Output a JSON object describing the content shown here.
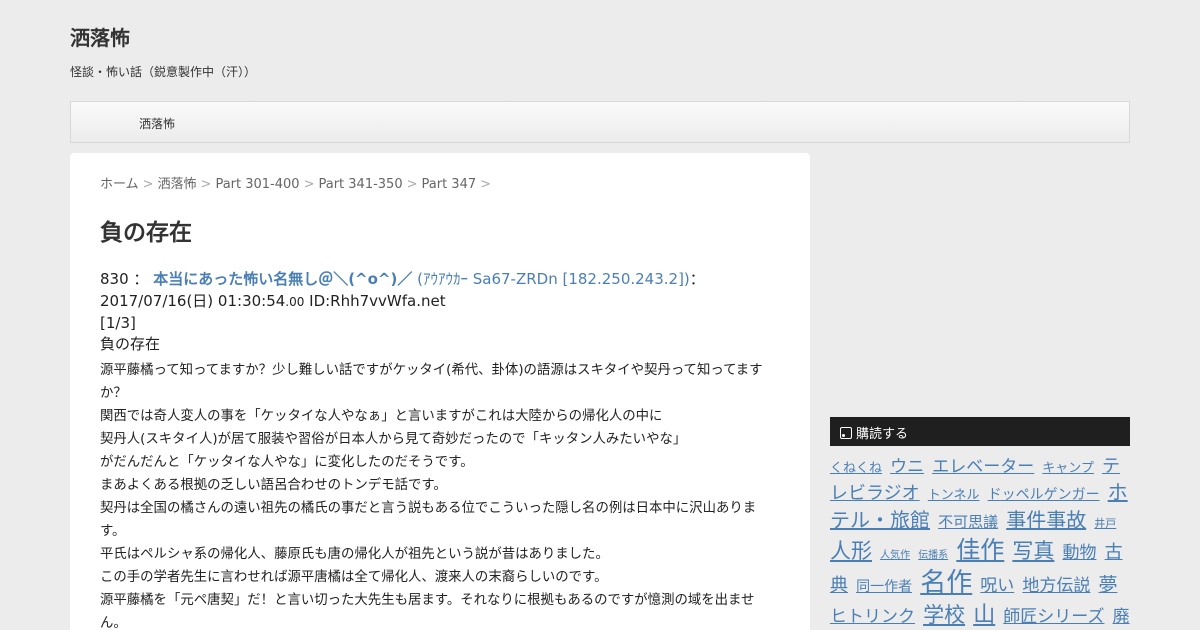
{
  "site": {
    "title": "洒落怖",
    "description": "怪談・怖い話（鋭意製作中（汗））"
  },
  "nav": {
    "items": [
      "洒落怖"
    ]
  },
  "breadcrumb": [
    "ホーム",
    "洒落怖",
    "Part 301-400",
    "Part 341-350",
    "Part 347"
  ],
  "post": {
    "title": "負の存在",
    "number": "830 ：",
    "poster_name": "本当にあった怖い名無し＠＼(^o^)／",
    "poster_id_link": "(ｱｳｱｳｶｰ Sa67-ZRDn [182.250.243.2])",
    "colon": "：",
    "datetime": "2017/07/16(日) 01:30:54",
    "datetime_ms": ".00",
    "user_id": " ID:Rhh7vvWfa.net",
    "part": "[1/3]",
    "subtitle": "負の存在",
    "lines": [
      "源平藤橘って知ってますか？少し難しい話ですがケッタイ(希代、卦体)の語源はスキタイや契丹って知ってますか？",
      "関西では奇人変人の事を「ケッタイな人やなぁ」と言いますがこれは大陸からの帰化人の中に",
      "契丹人(スキタイ人)が居て服装や習俗が日本人から見て奇妙だったので「キッタン人みたいやな」",
      "がだんだんと「ケッタイな人やな」に変化したのだそうです。",
      "まあよくある根拠の乏しい語呂合わせのトンデモ話です。",
      "契丹は全国の橘さんの遠い祖先の橘氏の事だと言う説もある位でこういった隠し名の例は日本中に沢山あります。",
      "平氏はペルシャ系の帰化人、藤原氏も唐の帰化人が祖先という説が昔はありました。",
      "この手の学者先生に言わせれば源平唐橘は全て帰化人、渡来人の末裔らしいのです。",
      "源平藤橘を「元ペ唐契」だ！と言い切った大先生も居ます。それなりに根拠もあるのですが憶測の域を出ません。"
    ]
  },
  "sidebar": {
    "feed_label": "購読する",
    "tags": [
      {
        "label": "くねくね",
        "size": 13
      },
      {
        "label": "ウニ",
        "size": 17
      },
      {
        "label": "エレベーター",
        "size": 17
      },
      {
        "label": "キャンプ",
        "size": 13
      },
      {
        "label": "テレビラジオ",
        "size": 18
      },
      {
        "label": "トンネル",
        "size": 13
      },
      {
        "label": "ドッペルゲンガー",
        "size": 14
      },
      {
        "label": "ホテル・旅館",
        "size": 20
      },
      {
        "label": "不可思議",
        "size": 15
      },
      {
        "label": "事件事故",
        "size": 20
      },
      {
        "label": "井戸",
        "size": 11
      },
      {
        "label": "人形",
        "size": 21
      },
      {
        "label": "人気作",
        "size": 10
      },
      {
        "label": "伝播系",
        "size": 10
      },
      {
        "label": "佳作",
        "size": 24
      },
      {
        "label": "写真",
        "size": 21
      },
      {
        "label": "動物",
        "size": 17
      },
      {
        "label": "古典",
        "size": 18
      },
      {
        "label": "同一作者",
        "size": 14
      },
      {
        "label": "名作",
        "size": 26
      },
      {
        "label": "呪い",
        "size": 17
      },
      {
        "label": "地方伝説",
        "size": 17
      },
      {
        "label": "夢",
        "size": 19
      },
      {
        "label": "ヒトリンク",
        "size": 17
      },
      {
        "label": "学校",
        "size": 21
      },
      {
        "label": "山",
        "size": 22
      },
      {
        "label": "師匠シリーズ",
        "size": 17
      },
      {
        "label": "廃墟",
        "size": 17
      }
    ]
  }
}
